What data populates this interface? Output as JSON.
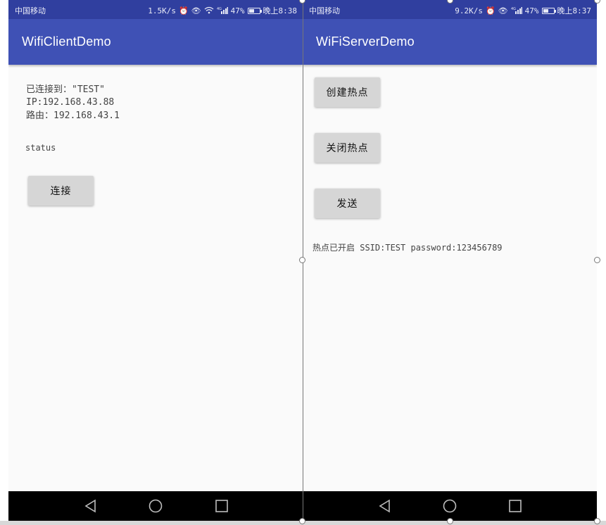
{
  "left": {
    "status": {
      "carrier": "中国移动",
      "speed": "1.5K/s",
      "network": "4G",
      "battery": "47%",
      "battery_level": 0.47,
      "time": "晚上8:38"
    },
    "app_title": "WifiClientDemo",
    "connected_line": "已连接到：\"TEST\"",
    "ip_line": "IP:192.168.43.88",
    "router_line": "路由：192.168.43.1",
    "status_text": "status",
    "connect_button": "连接"
  },
  "right": {
    "status": {
      "carrier": "中国移动",
      "speed": "9.2K/s",
      "network": "4G",
      "battery": "47%",
      "battery_level": 0.47,
      "time": "晚上8:37"
    },
    "app_title": "WiFiServerDemo",
    "create_hotspot_button": "创建热点",
    "close_hotspot_button": "关闭热点",
    "send_button": "发送",
    "hotspot_status": "热点已开启 SSID:TEST password:123456789"
  },
  "colors": {
    "status_bar": "#303f9f",
    "app_bar": "#3f51b5",
    "background": "#fafafa",
    "button": "#d6d6d6",
    "nav_bar": "#000000"
  },
  "icons": [
    "alarm-icon",
    "eye-icon",
    "wifi-icon",
    "signal-icon",
    "battery-icon",
    "back-icon",
    "home-icon",
    "recents-icon"
  ]
}
